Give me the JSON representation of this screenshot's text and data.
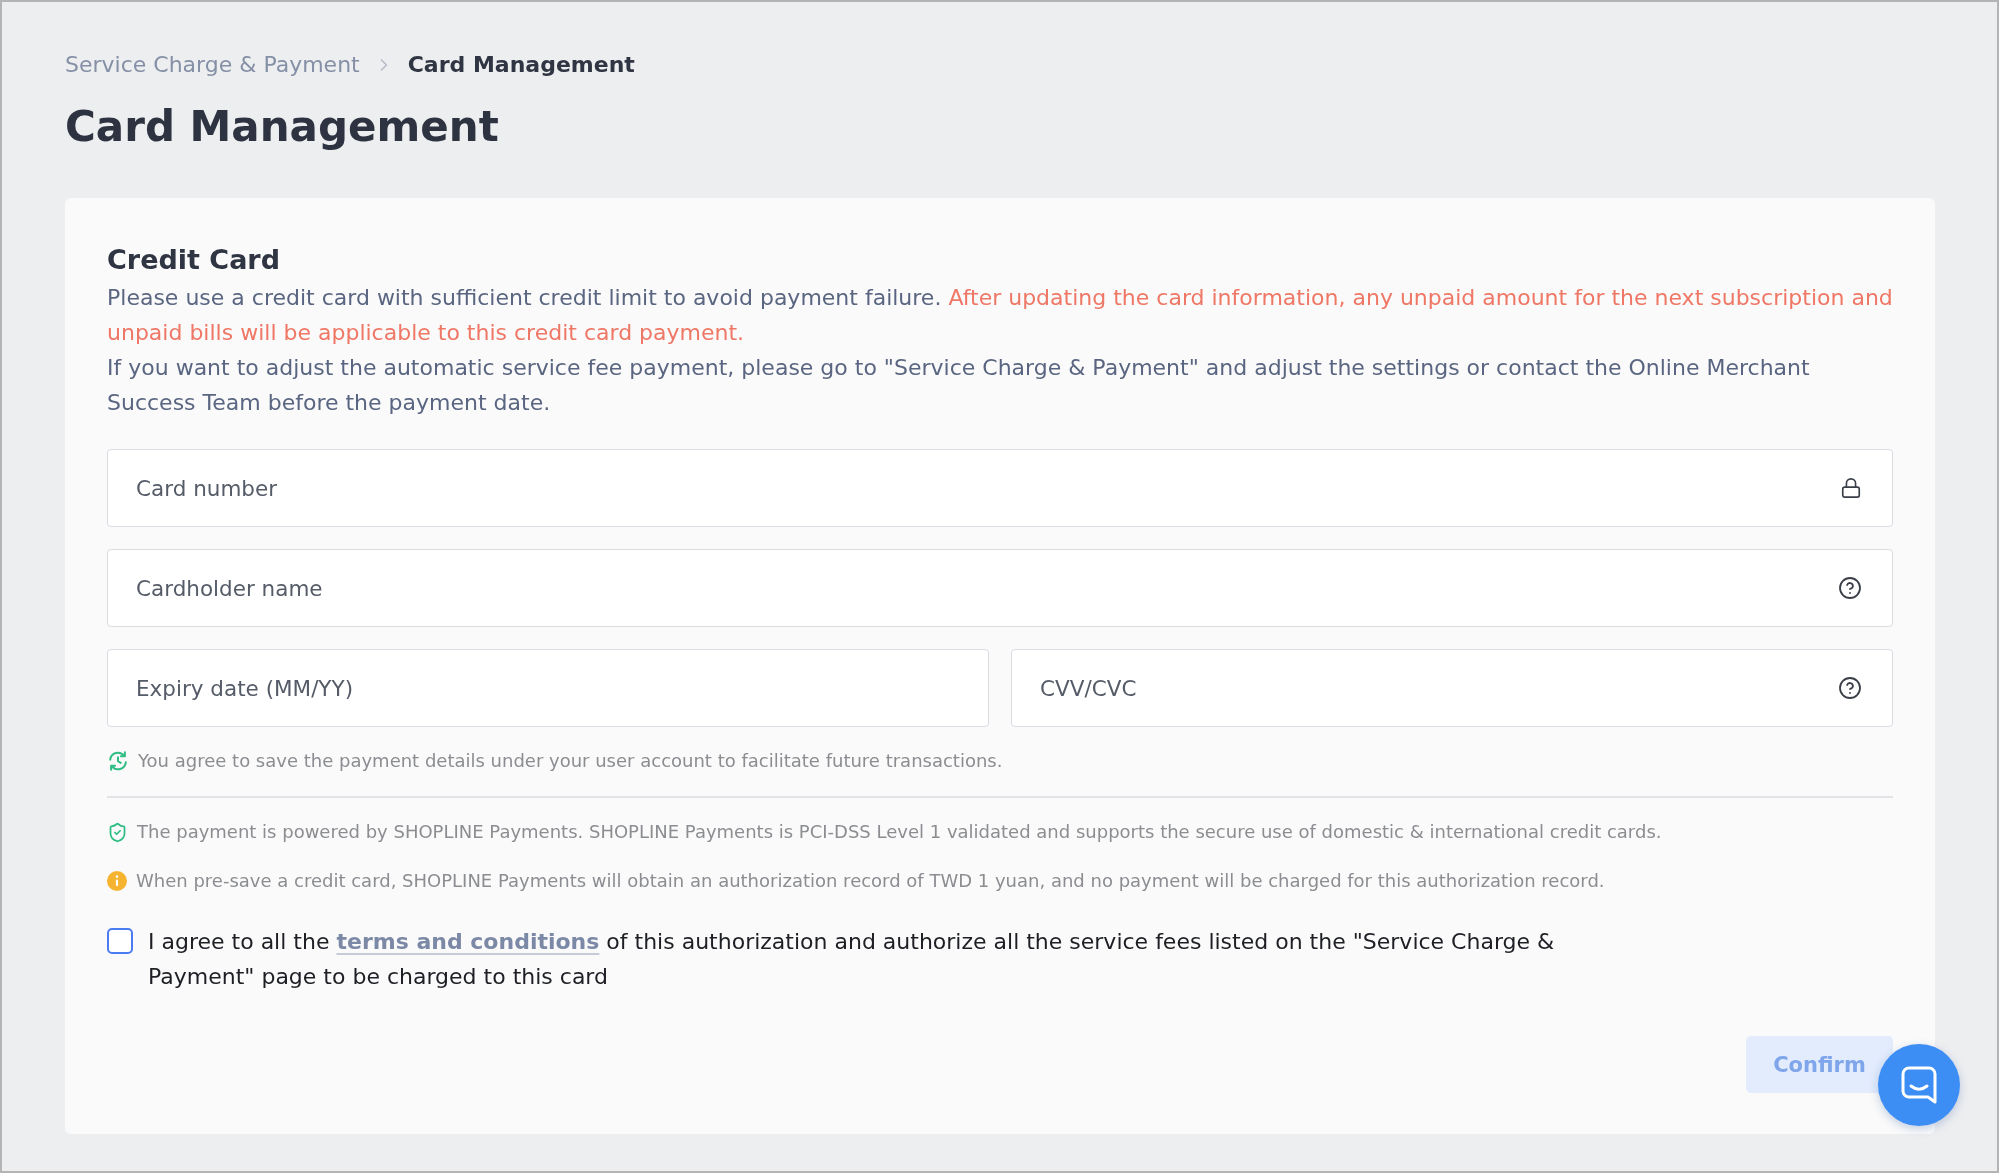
{
  "breadcrumb": [
    {
      "label": "Service Charge & Payment",
      "current": false
    },
    {
      "label": "Card Management",
      "current": true
    }
  ],
  "page_title": "Card Management",
  "credit_card": {
    "title": "Credit Card",
    "paragraphs": [
      {
        "segments": [
          {
            "kind": "normal",
            "text": "Please use a credit card with sufficient credit limit to avoid payment failure. "
          },
          {
            "kind": "warning",
            "text": "After updating the card information, any unpaid amount for the next subscription and unpaid bills will be applicable to this credit card payment."
          }
        ]
      },
      {
        "segments": [
          {
            "kind": "normal",
            "text": "If you want to adjust the automatic service fee payment, please go to \"Service Charge & Payment\" and adjust the settings or contact the Online Merchant Success Team before the payment date."
          }
        ]
      }
    ],
    "field_rows": [
      [
        {
          "placeholder": "Card number",
          "kind": "secure"
        }
      ],
      [
        {
          "placeholder": "Cardholder name",
          "kind": "help"
        }
      ],
      [
        {
          "placeholder": "Expiry date (MM/YY)",
          "kind": "plain"
        },
        {
          "placeholder": "CVV/CVC",
          "kind": "help"
        }
      ]
    ],
    "save_notice": {
      "kind": "saved",
      "text": "You agree to save the payment details under your user account to facilitate future transactions."
    },
    "payment_notes": [
      {
        "kind": "secure",
        "text": "The payment is powered by SHOPLINE Payments. SHOPLINE Payments is PCI-DSS Level 1 validated and supports the secure use of domestic & international credit cards."
      },
      {
        "kind": "info",
        "text": "When pre-save a credit card, SHOPLINE Payments will obtain an authorization record of TWD 1 yuan, and no payment will be charged for this authorization record."
      }
    ],
    "consent": {
      "checked": false,
      "before": "I agree to all the ",
      "link": "terms and conditions",
      "after": " of this authorization and authorize all the service fees listed on the \"Service Charge & Payment\" page to be charged to this card"
    },
    "confirm_button": {
      "label": "Confirm",
      "disabled": true
    }
  }
}
